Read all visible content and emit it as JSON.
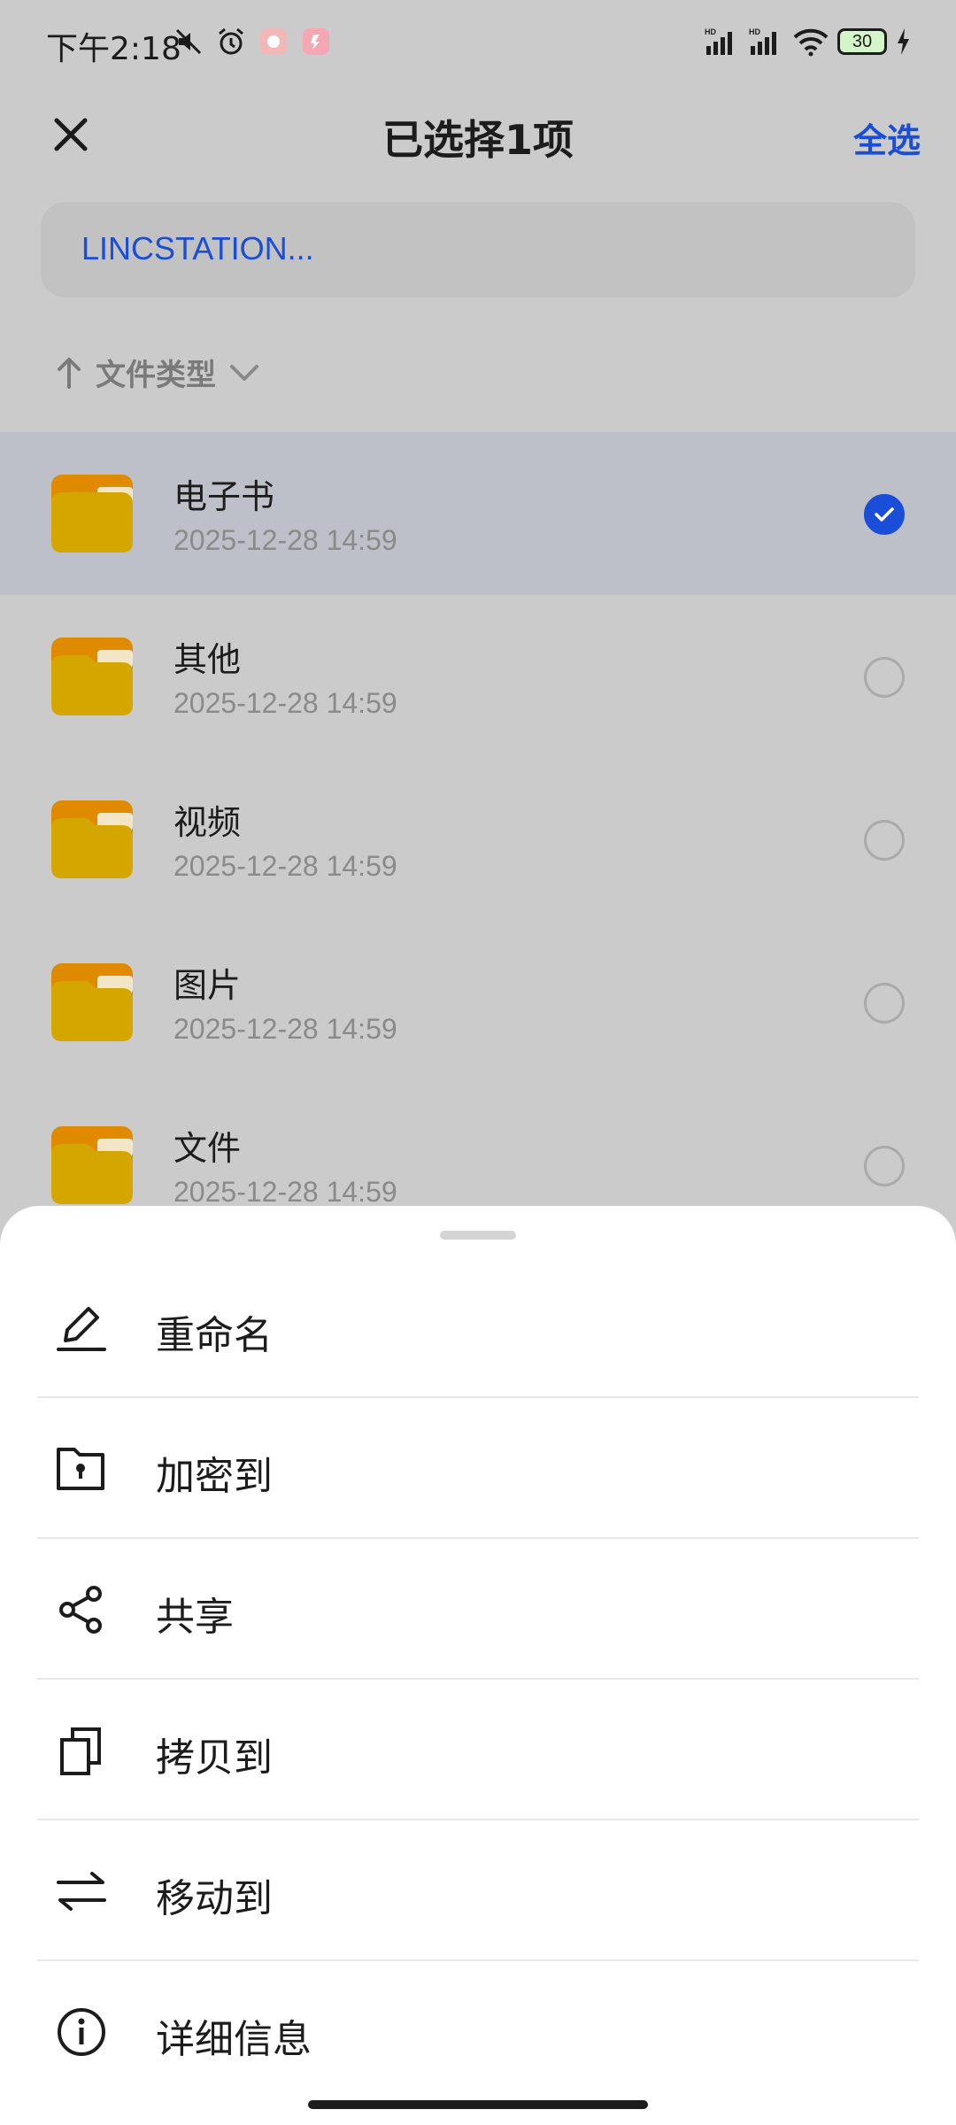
{
  "status_bar": {
    "time": "下午2:18",
    "battery": "30",
    "icons": [
      "mute-icon",
      "alarm-icon",
      "app-notification-icon",
      "app-notification-icon",
      "signal-icon",
      "signal-icon",
      "wifi-icon",
      "charging-icon"
    ]
  },
  "header": {
    "title": "已选择1项",
    "select_all": "全选",
    "close_icon": "close-icon"
  },
  "breadcrumb": {
    "path": "LINCSTATION..."
  },
  "sort": {
    "label": "文件类型",
    "direction_icon": "arrow-up-icon",
    "dropdown_icon": "chevron-down-icon"
  },
  "files": [
    {
      "name": "电子书",
      "date": "2025-12-28 14:59",
      "selected": true
    },
    {
      "name": "其他",
      "date": "2025-12-28 14:59",
      "selected": false
    },
    {
      "name": "视频",
      "date": "2025-12-28 14:59",
      "selected": false
    },
    {
      "name": "图片",
      "date": "2025-12-28 14:59",
      "selected": false
    },
    {
      "name": "文件",
      "date": "2025-12-28 14:59",
      "selected": false
    }
  ],
  "sheet": {
    "items": [
      {
        "label": "重命名",
        "icon": "pencil-icon"
      },
      {
        "label": "加密到",
        "icon": "lock-folder-icon"
      },
      {
        "label": "共享",
        "icon": "share-icon"
      },
      {
        "label": "拷贝到",
        "icon": "copy-icon"
      },
      {
        "label": "移动到",
        "icon": "transfer-icon"
      },
      {
        "label": "详细信息",
        "icon": "info-icon"
      }
    ]
  },
  "colors": {
    "accent": "#1a4dd8",
    "folder": "#d6a600",
    "folder_tab": "#e08a00",
    "dim_background": "#cbcbcb",
    "selected_row": "#bdc0c8"
  }
}
